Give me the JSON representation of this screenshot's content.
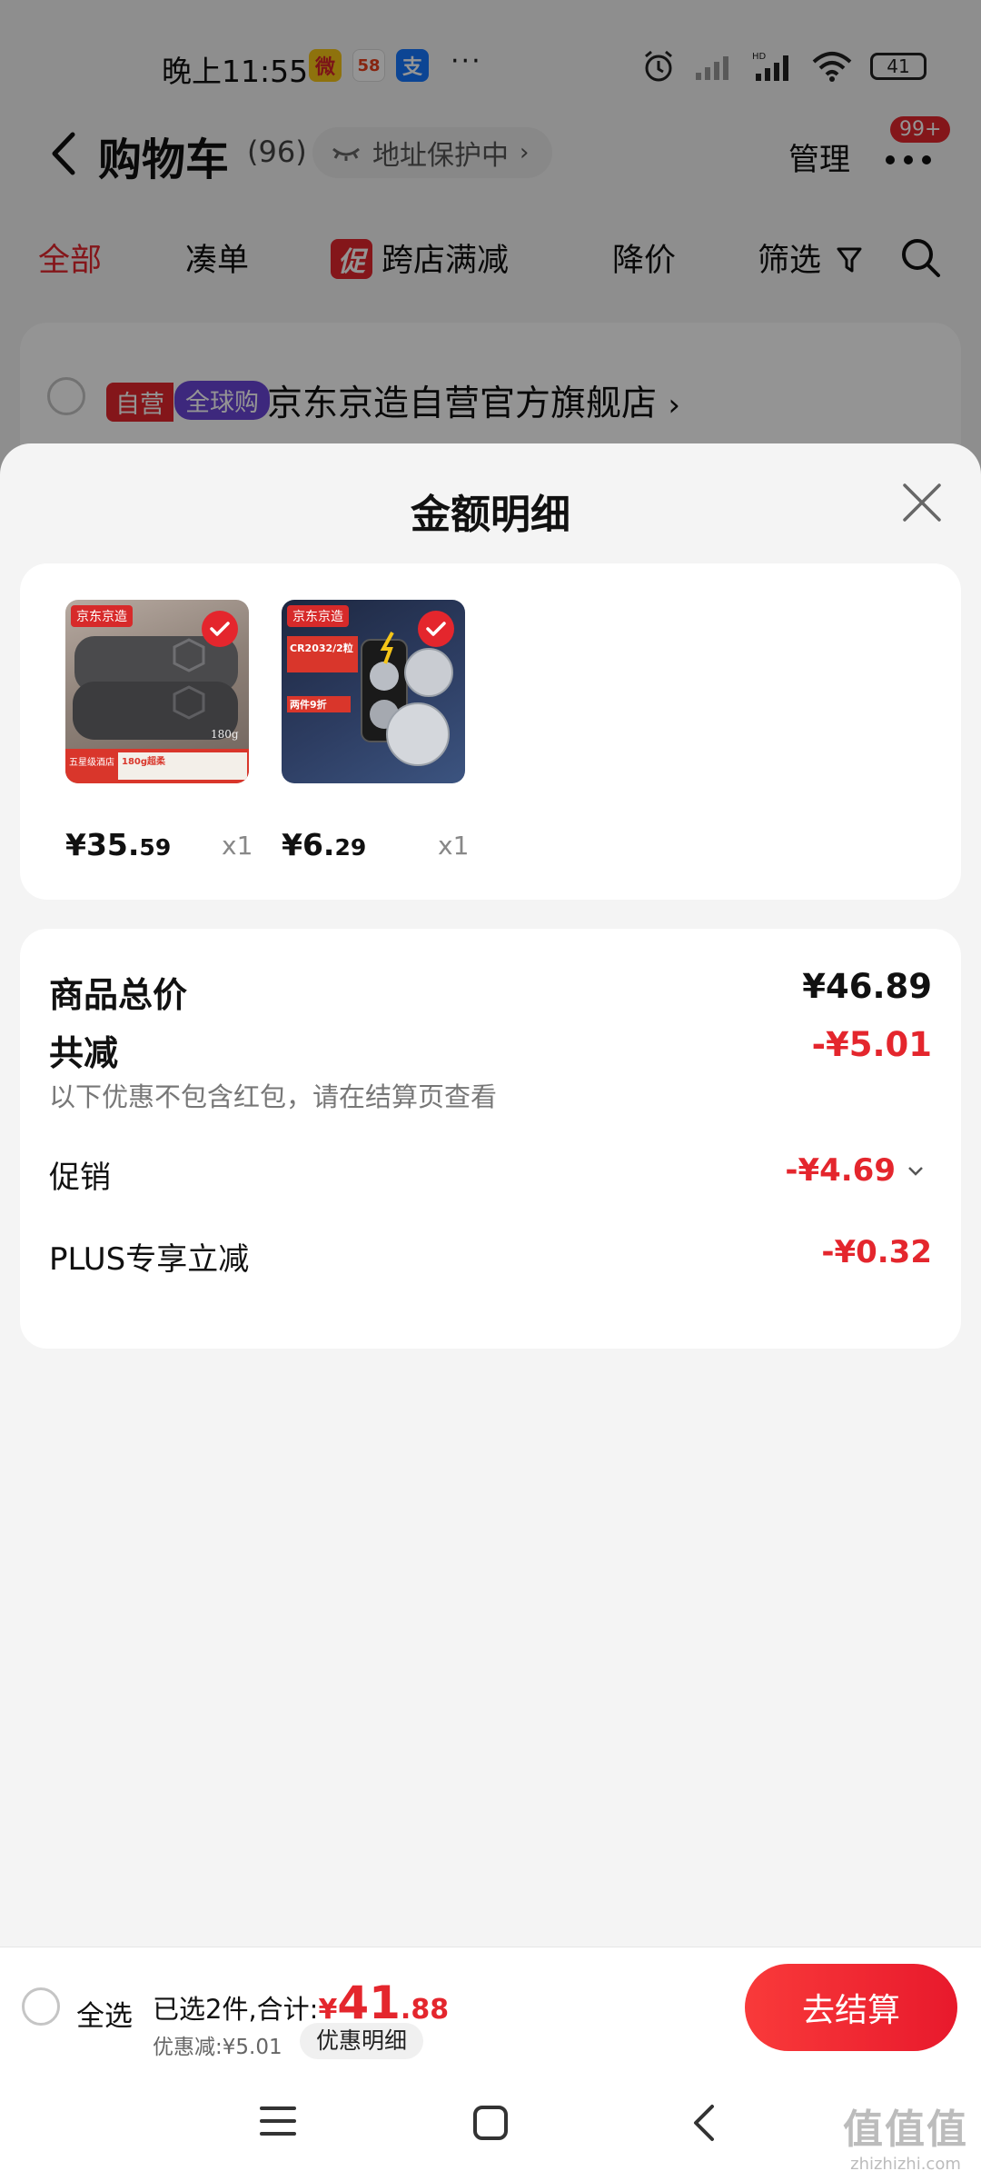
{
  "status_bar": {
    "time": "晚上11:55",
    "apps": [
      {
        "icon": "weibo-icon",
        "glyph": "微",
        "color": "#f5a623"
      },
      {
        "icon": "58-icon",
        "glyph": "58",
        "color": "#ffffff"
      },
      {
        "icon": "alipay-icon",
        "glyph": "支",
        "color": "#1677ff"
      }
    ],
    "more": "···",
    "battery": "41"
  },
  "nav": {
    "title": "购物车",
    "count": "(96)",
    "address_pill": "地址保护中",
    "manage": "管理",
    "badge": "99+"
  },
  "tabs": [
    {
      "label": "全部",
      "active": true
    },
    {
      "label": "凑单",
      "active": false
    },
    {
      "label": "跨店满减",
      "tag": "促",
      "active": false
    },
    {
      "label": "降价",
      "active": false
    },
    {
      "label": "筛选",
      "active": false
    }
  ],
  "store": {
    "tag_self": "自营",
    "tag_global": "全球购",
    "name": "京东京造自营官方旗舰店"
  },
  "sheet": {
    "title": "金额明细",
    "products": [
      {
        "brand": "京东京造",
        "price_int": "¥35.",
        "price_dec": "59",
        "qty": "x1",
        "image": "towel-product-image",
        "img_text_1": "五星级酒店",
        "img_text_2": "180g超柔",
        "img_weight": "180g"
      },
      {
        "brand": "京东京造",
        "price_int": "¥6.",
        "price_dec": "29",
        "qty": "x1",
        "image": "battery-product-image",
        "img_text_1": "CR2032/2粒",
        "img_text_2": "两件9折"
      }
    ],
    "summary": {
      "total_label": "商品总价",
      "total_value": "¥46.89",
      "reduce_label": "共减",
      "reduce_value": "-¥5.01",
      "note": "以下优惠不包含红包，请在结算页查看",
      "promo_label": "促销",
      "promo_value": "-¥4.69",
      "plus_label": "PLUS专享立减",
      "plus_value": "-¥0.32"
    }
  },
  "checkout": {
    "select_all": "全选",
    "selected_text": "已选2件,合计:",
    "total_symbol": "¥",
    "total_int": "41",
    "total_dec": ".88",
    "discount": "优惠减:¥5.01",
    "detail_button": "优惠明细",
    "checkout_button": "去结算"
  },
  "watermark": {
    "big": "值值值",
    "small": "zhizhizhi.com"
  },
  "colors": {
    "accent": "#e4262d",
    "global_tag": "#6a46d8"
  }
}
